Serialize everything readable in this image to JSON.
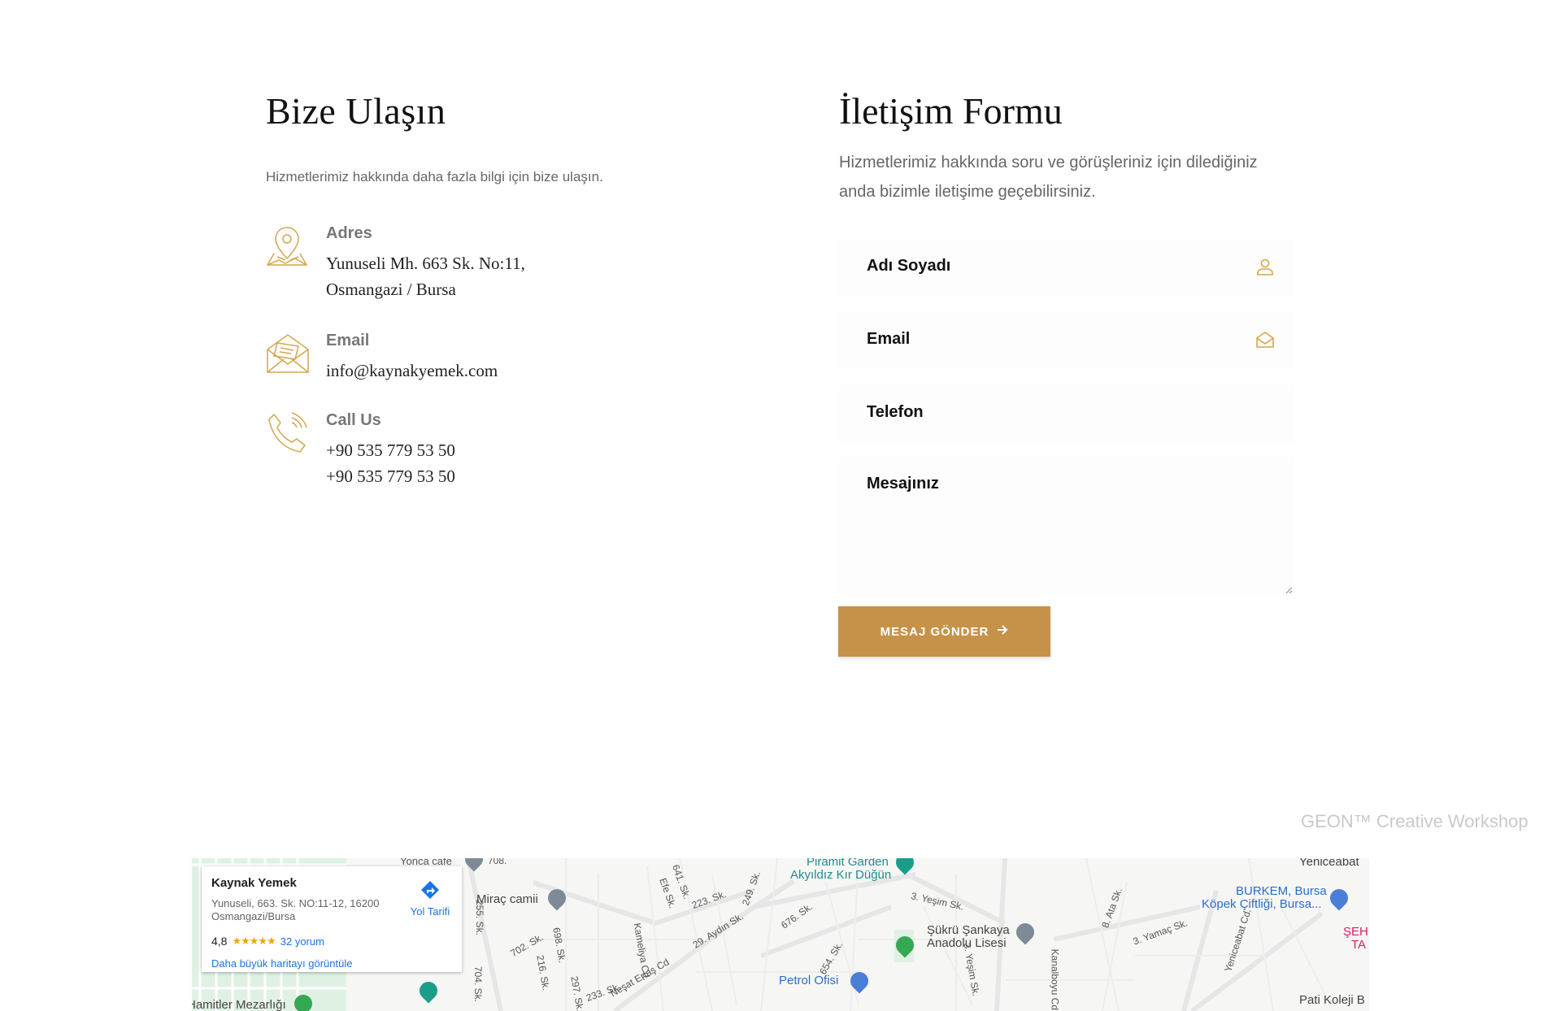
{
  "contact": {
    "title": "Bize Ulaşın",
    "subtitle": "Hizmetlerimiz hakkında daha fazla bilgi için bize ulaşın.",
    "address": {
      "label": "Adres",
      "line1": "Yunuseli Mh. 663 Sk. No:11,",
      "line2": "Osmangazi / Bursa",
      "icon": "map-pin-icon"
    },
    "email": {
      "label": "Email",
      "value": "info@kaynakyemek.com",
      "icon": "envelope-icon"
    },
    "phone": {
      "label": "Call Us",
      "line1": "+90 535 779 53 50",
      "line2": "+90 535 779 53 50",
      "icon": "phone-icon"
    }
  },
  "form": {
    "title": "İletişim Formu",
    "subtitle": "Hizmetlerimiz hakkında soru ve görüşleriniz için dilediğiniz anda bizimle iletişime geçebilirsiniz.",
    "fields": {
      "name": "Adı Soyadı",
      "email": "Email",
      "phone": "Telefon",
      "message": "Mesajınız"
    },
    "submit_label": "MESAJ GÖNDER",
    "submit_icon": "arrow-right-icon"
  },
  "watermark": "GEON™ Creative Workshop",
  "colors": {
    "accent": "#c6924a",
    "icon": "#d4a64f"
  },
  "map": {
    "card": {
      "name": "Kaynak Yemek",
      "address": "Yunuseli, 663. Sk. NO:11-12, 16200 Osmangazi/Bursa",
      "rating": "4,8",
      "stars": "★★★★★",
      "reviews": "32 yorum",
      "directions": "Yol Tarifi",
      "larger_map": "Daha büyük haritayı görüntüle"
    },
    "labels": {
      "yonca": "Yonca cafe",
      "mirac": "Miraç camii",
      "piramit1": "Piramit Garden",
      "piramit2": "Akyıldız Kır Düğün",
      "sukru1": "Şükrü Şankaya",
      "sukru2": "Anadolu Lisesi",
      "petrol": "Petrol Ofisi",
      "burkem1": "BURKEM, Bursa",
      "burkem2": "Köpek Çiftliği, Bursa...",
      "seh1": "ŞEH",
      "seh2": "TA",
      "yeniceabat": "Yeniceabat",
      "pati": "Pati Koleji B",
      "hamitler": "Hamitler Mezarlığı",
      "aydin": "29. Aydın Sk.",
      "nesat": "Neşat Ertaş Cd",
      "yamac": "3. Yamaç Sk.",
      "yesim": "3. Yeşim Sk.",
      "yeniceabatcd": "Yeniceabat Cd.",
      "kanalboyu": "Kanalboyu Cd.",
      "sk676": "676. Sk.",
      "sk654": "654. Sk.",
      "sk702": "702. Sk.",
      "sk698": "698. Sk.",
      "sk255": "255. Sk.",
      "sk704": "704. Sk.",
      "sk216": "216. Sk.",
      "sk297": "297. Sk.",
      "sk233": "233. Sk.",
      "sk223": "223. Sk.",
      "sk249": "249. Sk.",
      "sk641": "641. Sk.",
      "efe": "Efe Sk.",
      "ata": "8. Ata Sk.",
      "kameliya": "Kameliya Cd.",
      "yesim3": "3. Yeşim Sk.",
      "sk708": "708."
    }
  }
}
